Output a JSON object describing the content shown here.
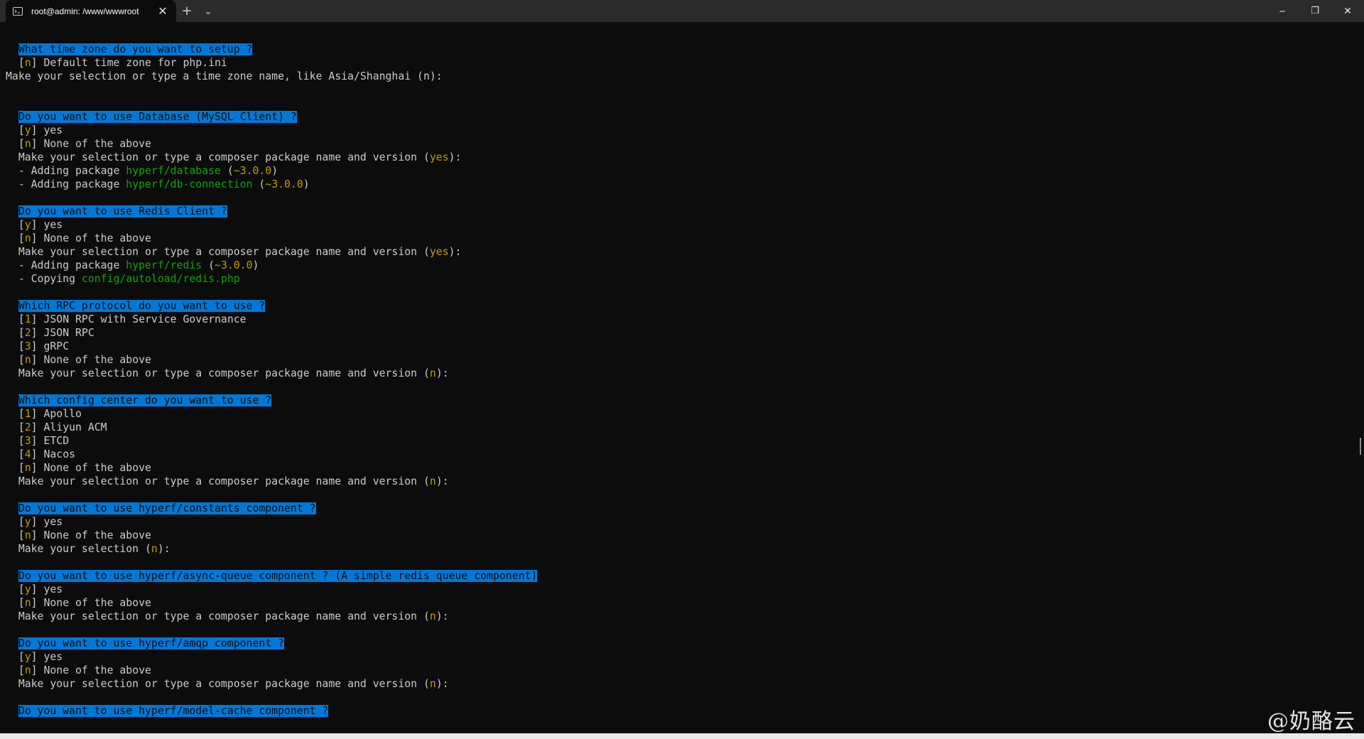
{
  "window": {
    "tab_title": "root@admin: /www/wwwroot",
    "tab_close": "✕",
    "new_tab": "+",
    "tab_dropdown": "⌄",
    "minimize": "─",
    "restore": "❐",
    "close": "✕"
  },
  "colors": {
    "background": "#0c0c0c",
    "text": "#cccccc",
    "highlight": "#0078d7",
    "yellow": "#c19c00",
    "green": "#13a10e"
  },
  "terminal": {
    "lines": [
      {
        "t": "q",
        "text": "What time zone do you want to setup ?"
      },
      {
        "t": "opt",
        "key": "n",
        "text": "Default time zone for php.ini"
      },
      {
        "t": "plain",
        "text": "Make your selection or type a time zone name, like Asia/Shanghai (n):"
      },
      {
        "t": "blank"
      },
      {
        "t": "blank"
      },
      {
        "t": "q",
        "text": "Do you want to use Database (MySQL Client) ?"
      },
      {
        "t": "opt",
        "key": "y",
        "text": "yes"
      },
      {
        "t": "opt",
        "key": "n",
        "text": "None of the above"
      },
      {
        "t": "prompt",
        "text": "Make your selection or type a composer package name and version",
        "default": "yes"
      },
      {
        "t": "pkg",
        "prefix": "- Adding package",
        "name": "hyperf/database",
        "version": "~3.0.0"
      },
      {
        "t": "pkg",
        "prefix": "- Adding package",
        "name": "hyperf/db-connection",
        "version": "~3.0.0"
      },
      {
        "t": "blank"
      },
      {
        "t": "q",
        "text": "Do you want to use Redis Client ?"
      },
      {
        "t": "opt",
        "key": "y",
        "text": "yes"
      },
      {
        "t": "opt",
        "key": "n",
        "text": "None of the above"
      },
      {
        "t": "prompt",
        "text": "Make your selection or type a composer package name and version",
        "default": "yes"
      },
      {
        "t": "pkg",
        "prefix": "- Adding package",
        "name": "hyperf/redis",
        "version": "~3.0.0"
      },
      {
        "t": "copy",
        "prefix": "- Copying",
        "name": "config/autoload/redis.php"
      },
      {
        "t": "blank"
      },
      {
        "t": "q",
        "text": "Which RPC protocol do you want to use ?"
      },
      {
        "t": "opt",
        "key": "1",
        "text": "JSON RPC with Service Governance"
      },
      {
        "t": "opt",
        "key": "2",
        "text": "JSON RPC"
      },
      {
        "t": "opt",
        "key": "3",
        "text": "gRPC"
      },
      {
        "t": "opt",
        "key": "n",
        "text": "None of the above"
      },
      {
        "t": "prompt",
        "text": "Make your selection or type a composer package name and version",
        "default": "n"
      },
      {
        "t": "blank"
      },
      {
        "t": "q",
        "text": "Which config center do you want to use ?"
      },
      {
        "t": "opt",
        "key": "1",
        "text": "Apollo"
      },
      {
        "t": "opt",
        "key": "2",
        "text": "Aliyun ACM"
      },
      {
        "t": "opt",
        "key": "3",
        "text": "ETCD"
      },
      {
        "t": "opt",
        "key": "4",
        "text": "Nacos"
      },
      {
        "t": "opt",
        "key": "n",
        "text": "None of the above"
      },
      {
        "t": "prompt",
        "text": "Make your selection or type a composer package name and version",
        "default": "n"
      },
      {
        "t": "blank"
      },
      {
        "t": "q",
        "text": "Do you want to use hyperf/constants component ?"
      },
      {
        "t": "opt",
        "key": "y",
        "text": "yes"
      },
      {
        "t": "opt",
        "key": "n",
        "text": "None of the above"
      },
      {
        "t": "prompt",
        "text": "Make your selection",
        "default": "n"
      },
      {
        "t": "blank"
      },
      {
        "t": "q",
        "text": "Do you want to use hyperf/async-queue component ? (A simple redis queue component)"
      },
      {
        "t": "opt",
        "key": "y",
        "text": "yes"
      },
      {
        "t": "opt",
        "key": "n",
        "text": "None of the above"
      },
      {
        "t": "prompt",
        "text": "Make your selection or type a composer package name and version",
        "default": "n"
      },
      {
        "t": "blank"
      },
      {
        "t": "q",
        "text": "Do you want to use hyperf/amqp component ?"
      },
      {
        "t": "opt",
        "key": "y",
        "text": "yes"
      },
      {
        "t": "opt",
        "key": "n",
        "text": "None of the above"
      },
      {
        "t": "prompt",
        "text": "Make your selection or type a composer package name and version",
        "default": "n"
      },
      {
        "t": "blank"
      },
      {
        "t": "q",
        "text": "Do you want to use hyperf/model-cache component ?"
      }
    ]
  },
  "watermark": "@奶酪云"
}
